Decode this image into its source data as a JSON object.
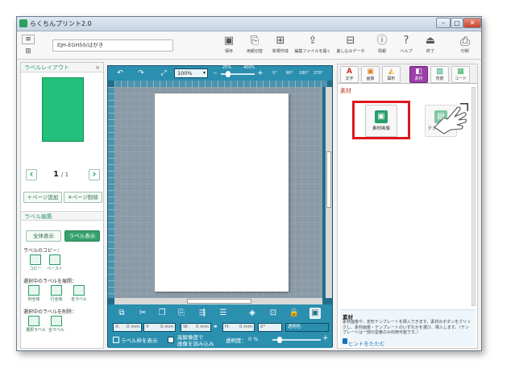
{
  "window": {
    "title": "らくちんプリント2.0",
    "controls": {
      "minimize": "–",
      "maximize": "□",
      "close": "✕"
    }
  },
  "toolbar": {
    "model": "EJH-EGH50/はがき",
    "buttons": [
      {
        "label": "保存",
        "icon": "floppy-icon",
        "glyph": "▣"
      },
      {
        "label": "用紙切替",
        "icon": "paper-switch-icon",
        "glyph": "⎘"
      },
      {
        "label": "新規作成",
        "icon": "new-file-icon",
        "glyph": "⊞"
      },
      {
        "label": "編集ファイルを開く",
        "icon": "open-file-icon",
        "glyph": "⇪"
      },
      {
        "label": "差し込みデータ",
        "icon": "merge-data-icon",
        "glyph": "⊟"
      },
      {
        "label": "情報",
        "icon": "info-icon",
        "glyph": "ⓘ"
      },
      {
        "label": "ヘルプ",
        "icon": "help-icon",
        "glyph": "?"
      },
      {
        "label": "終了",
        "icon": "exit-icon",
        "glyph": "⏏"
      },
      {
        "label": "印刷",
        "icon": "printer-icon",
        "glyph": "⎙"
      }
    ]
  },
  "left_panel": {
    "header": "ラベルレイアウト",
    "close": "×",
    "page_current": "1",
    "page_total": "/ 1",
    "prev": "‹",
    "next": "›",
    "add_page": "＋ページ追加",
    "delete_page": "✕ページ削除",
    "edit_header": "ラベル編集",
    "view_all": "全体表示",
    "view_label": "ラベル表示",
    "copy_header": "ラベルのコピー：",
    "copy_items": [
      "コピー",
      "ペースト"
    ],
    "expand_header": "選択中のラベルを展開：",
    "expand_items": [
      "列全体",
      "行全体",
      "全ラベル"
    ],
    "delete_header": "選択中のラベルを削除：",
    "delete_items": [
      "選択ラベル",
      "全ラベル"
    ],
    "accent_color": "#22c07a"
  },
  "canvas": {
    "zoom": "100%",
    "zoom_marks": [
      "25%",
      "400%"
    ],
    "rotation_buttons": [
      "0°",
      "90°",
      "180°",
      "270°"
    ],
    "coords": {
      "x": "X:",
      "x_val": "0 mm",
      "y": "Y:",
      "y_val": "0 mm",
      "w": "W:",
      "w_val": "0 mm",
      "h": "H:",
      "h_val": "0 mm",
      "angle": "0°",
      "transparent": "透明色"
    },
    "show_frame": "ラベル枠を表示",
    "high_res": "高解像度で",
    "high_res2": "画像を読み込み",
    "opacity_label": "透明度：",
    "opacity_val": "0 %"
  },
  "right_panel": {
    "tabs": [
      {
        "label": "文字",
        "glyph": "A",
        "color": "#d0342c",
        "active": false
      },
      {
        "label": "画像",
        "glyph": "▣",
        "color": "#e67e22",
        "active": false
      },
      {
        "label": "図形",
        "glyph": "◭",
        "color": "#e0a21a",
        "active": false
      },
      {
        "label": "素材",
        "glyph": "◧",
        "color": "#9b3fa8",
        "active": true
      },
      {
        "label": "背景",
        "glyph": "▨",
        "color": "#16a085",
        "active": false
      },
      {
        "label": "コード",
        "glyph": "▦",
        "color": "#27ae60",
        "active": false
      }
    ],
    "section_title": "素材",
    "material_image": "素材画像",
    "template": "テンプレート",
    "hint_title": "素材",
    "hint_text": "素材画像や、定形テンプレートを挿入できます。素材のボタンをクリックし、素材画像・テンプレートのいずれかを選び、挿入します。（テンプレートは一部の型番のみ利用可能です。）",
    "hint_link": "ヒントをたたむ"
  }
}
